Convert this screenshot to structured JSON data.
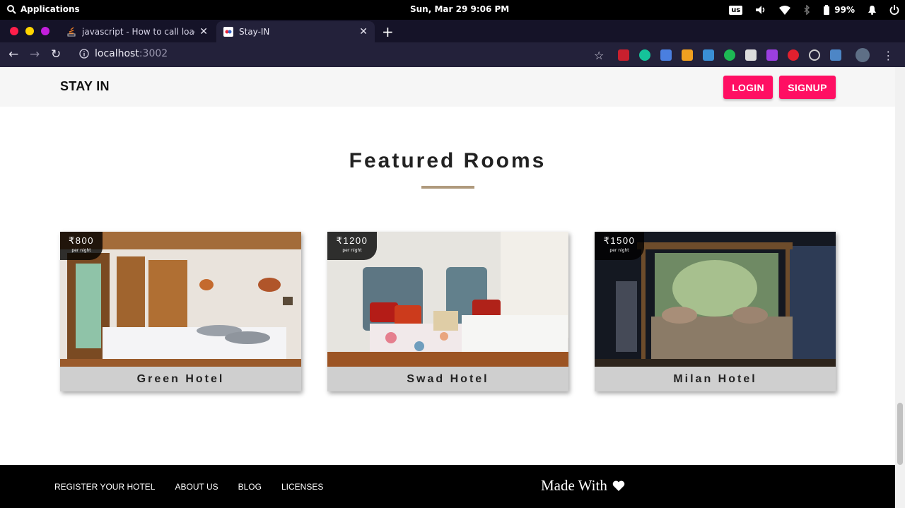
{
  "os": {
    "apps_label": "Applications",
    "clock": "Sun, Mar 29   9:06 PM",
    "keyboard_layout": "us",
    "battery": "99%"
  },
  "browser": {
    "tabs": [
      {
        "title": "javascript - How to call loading function with React useEffect only once - Stack Overflow",
        "active": false
      },
      {
        "title": "Stay-IN",
        "active": true
      }
    ],
    "url_host": "localhost",
    "url_port": ":3002"
  },
  "site": {
    "brand": "STAY IN",
    "login_label": "LOGIN",
    "signup_label": "SIGNUP",
    "section_title": "Featured Rooms",
    "rooms": [
      {
        "name": "Green Hotel",
        "price": "₹800",
        "unit": "per night"
      },
      {
        "name": "Swad Hotel",
        "price": "₹1200",
        "unit": "per night"
      },
      {
        "name": "Milan Hotel",
        "price": "₹1500",
        "unit": "per night"
      }
    ],
    "footer": {
      "links": [
        "REGISTER YOUR HOTEL",
        "ABOUT US",
        "BLOG",
        "LICENSES"
      ],
      "made_with": "Made With"
    }
  },
  "colors": {
    "accent_pink": "#ff0f63",
    "title_underline": "#af9a7d",
    "footer_bg": "#000000"
  }
}
